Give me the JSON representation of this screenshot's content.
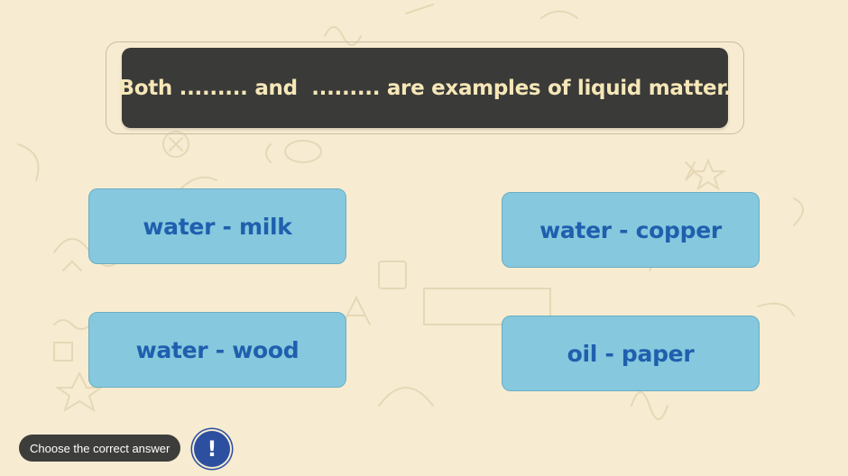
{
  "question": {
    "text": "Both ......... and  ......... are examples of liquid matter."
  },
  "options": [
    {
      "label": "water - milk"
    },
    {
      "label": "water - copper"
    },
    {
      "label": "water - wood"
    },
    {
      "label": "oil - paper"
    }
  ],
  "footer": {
    "hint": "Choose the correct answer",
    "info_icon": "!"
  },
  "colors": {
    "background": "#f7ecd1",
    "question_bg": "#3a3a38",
    "question_text": "#f6e7b8",
    "option_bg": "#86c8dd",
    "option_text": "#1f5fae",
    "info_button": "#2d4fa0"
  }
}
